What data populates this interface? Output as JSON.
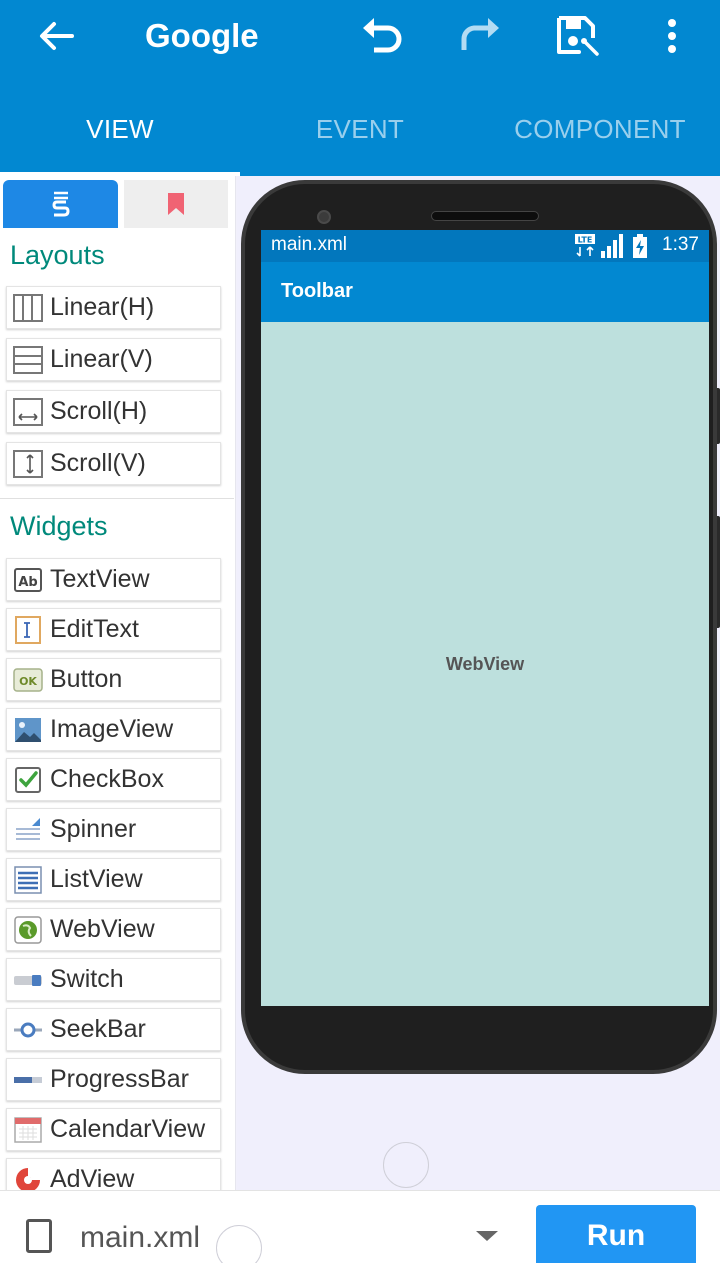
{
  "header": {
    "title": "Google",
    "tabs": [
      {
        "label": "VIEW",
        "active": true
      },
      {
        "label": "EVENT",
        "active": false
      },
      {
        "label": "COMPONENT",
        "active": false
      }
    ],
    "icons": [
      "back-arrow-icon",
      "undo-icon",
      "redo-icon",
      "save-icon",
      "more-vert-icon"
    ],
    "background_color": "#0288d1"
  },
  "palette": {
    "layouts_title": "Layouts",
    "layouts": [
      {
        "label": "Linear(H)",
        "icon": "linear-horizontal-icon"
      },
      {
        "label": "Linear(V)",
        "icon": "linear-vertical-icon"
      },
      {
        "label": "Scroll(H)",
        "icon": "scroll-horizontal-icon"
      },
      {
        "label": "Scroll(V)",
        "icon": "scroll-vertical-icon"
      }
    ],
    "widgets_title": "Widgets",
    "widgets": [
      {
        "label": "TextView",
        "icon": "textview-icon"
      },
      {
        "label": "EditText",
        "icon": "edittext-icon"
      },
      {
        "label": "Button",
        "icon": "button-icon"
      },
      {
        "label": "ImageView",
        "icon": "imageview-icon"
      },
      {
        "label": "CheckBox",
        "icon": "checkbox-icon"
      },
      {
        "label": "Spinner",
        "icon": "spinner-icon"
      },
      {
        "label": "ListView",
        "icon": "listview-icon"
      },
      {
        "label": "WebView",
        "icon": "webview-icon"
      },
      {
        "label": "Switch",
        "icon": "switch-icon"
      },
      {
        "label": "SeekBar",
        "icon": "seekbar-icon"
      },
      {
        "label": "ProgressBar",
        "icon": "progressbar-icon"
      },
      {
        "label": "CalendarView",
        "icon": "calendarview-icon"
      },
      {
        "label": "AdView",
        "icon": "adview-icon"
      }
    ],
    "accent_color": "#00897b"
  },
  "preview": {
    "status_file": "main.xml",
    "status_time": "1:37",
    "status_network": "LTE",
    "toolbar_title": "Toolbar",
    "webview_label": "WebView",
    "webview_color": "#bde0dd"
  },
  "bottom": {
    "file_name": "main.xml",
    "run_label": "Run",
    "run_color": "#2196f3"
  }
}
